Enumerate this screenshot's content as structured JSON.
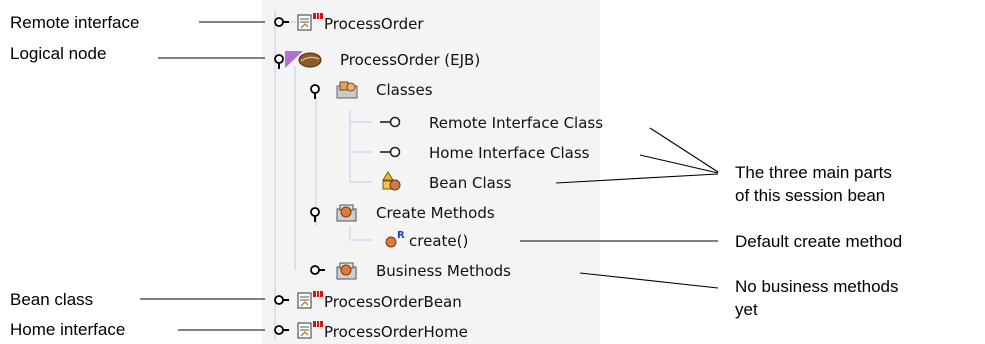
{
  "tree": {
    "nodes": [
      {
        "id": "n1",
        "label": "ProcessOrder",
        "icon": "interface-source-icon"
      },
      {
        "id": "n2",
        "label": "ProcessOrder (EJB)",
        "icon": "bean-logical-node-icon"
      },
      {
        "id": "n3",
        "label": "Classes",
        "icon": "classes-folder-icon"
      },
      {
        "id": "n4",
        "label": "Remote Interface Class",
        "icon": "interface-connector-icon"
      },
      {
        "id": "n5",
        "label": "Home Interface Class",
        "icon": "interface-connector-icon"
      },
      {
        "id": "n6",
        "label": "Bean Class",
        "icon": "bean-class-icon"
      },
      {
        "id": "n7",
        "label": "Create Methods",
        "icon": "methods-folder-icon"
      },
      {
        "id": "n8",
        "label": "create()",
        "icon": "method-icon"
      },
      {
        "id": "n9",
        "label": "Business Methods",
        "icon": "methods-folder-icon"
      },
      {
        "id": "n10",
        "label": "ProcessOrderBean",
        "icon": "interface-source-icon"
      },
      {
        "id": "n11",
        "label": "ProcessOrderHome",
        "icon": "interface-source-icon"
      }
    ],
    "method_badge": "R"
  },
  "callouts": {
    "left": [
      {
        "label": "Remote interface"
      },
      {
        "label": "Logical node"
      },
      {
        "label": "Bean class"
      },
      {
        "label": "Home interface"
      }
    ],
    "right": {
      "main_parts_line1": "The three main parts",
      "main_parts_line2": "of this session bean",
      "default_create": "Default create method",
      "no_business_line1": "No business methods",
      "no_business_line2": "yet"
    }
  },
  "colors": {
    "panel_bg": "#f4f4f4",
    "tree_line": "#c7c7f0",
    "selection_flag": "#b36fd6",
    "bean_brown": "#8a5a2b",
    "method_orange": "#e07a3a",
    "badge_blue": "#1f3fd1"
  }
}
